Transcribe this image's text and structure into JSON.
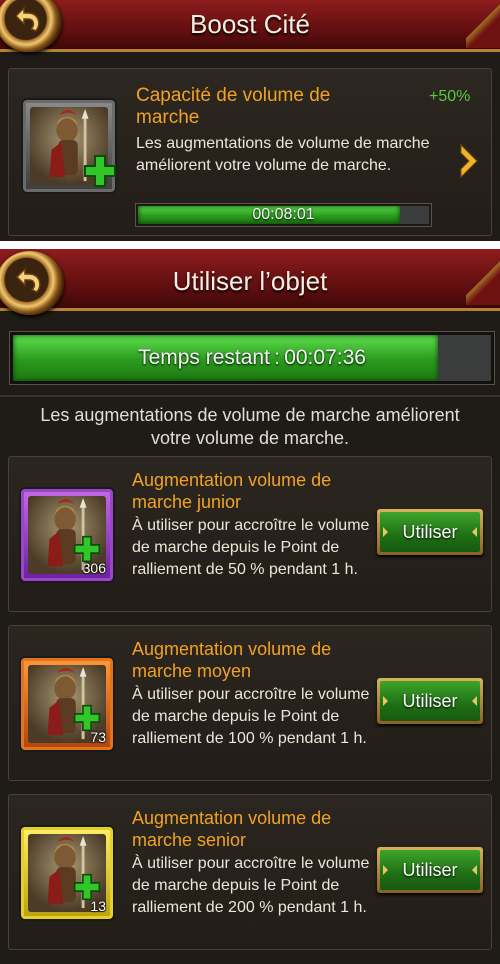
{
  "boost_panel": {
    "title": "Boost Cité",
    "card": {
      "icon": "spartan-soldier-icon",
      "title": "Capacité de volume de marche",
      "percent": "+50%",
      "description": "Les augmentations de volume de marche améliorent votre volume de marche.",
      "timer": "00:08:01",
      "progress": 0.9
    }
  },
  "use_item_panel": {
    "title": "Utiliser l’objet",
    "remaining": {
      "label": "Temps restant : 00:07:36",
      "progress": 0.89
    },
    "info": "Les augmentations de volume de marche améliorent votre volume de marche.",
    "items": [
      {
        "rarity": "purple",
        "count": "306",
        "title": "Augmentation volume de marche junior",
        "description": "À utiliser pour accroître le volume de marche depuis le Point de ralliement de 50 % pendant 1 h.",
        "button": "Utiliser"
      },
      {
        "rarity": "orange",
        "count": "73",
        "title": "Augmentation volume de marche moyen",
        "description": "À utiliser pour accroître le volume de marche depuis le Point de ralliement de 100 % pendant 1 h.",
        "button": "Utiliser"
      },
      {
        "rarity": "gold",
        "count": "13",
        "title": "Augmentation volume de marche senior",
        "description": "À utiliser pour accroître le volume de marche depuis le Point de ralliement de 200 % pendant 1 h.",
        "button": "Utiliser"
      }
    ]
  },
  "colors": {
    "accent_orange": "#f2a223",
    "positive_green": "#56c93a",
    "header_red": "#8e1c1d"
  }
}
